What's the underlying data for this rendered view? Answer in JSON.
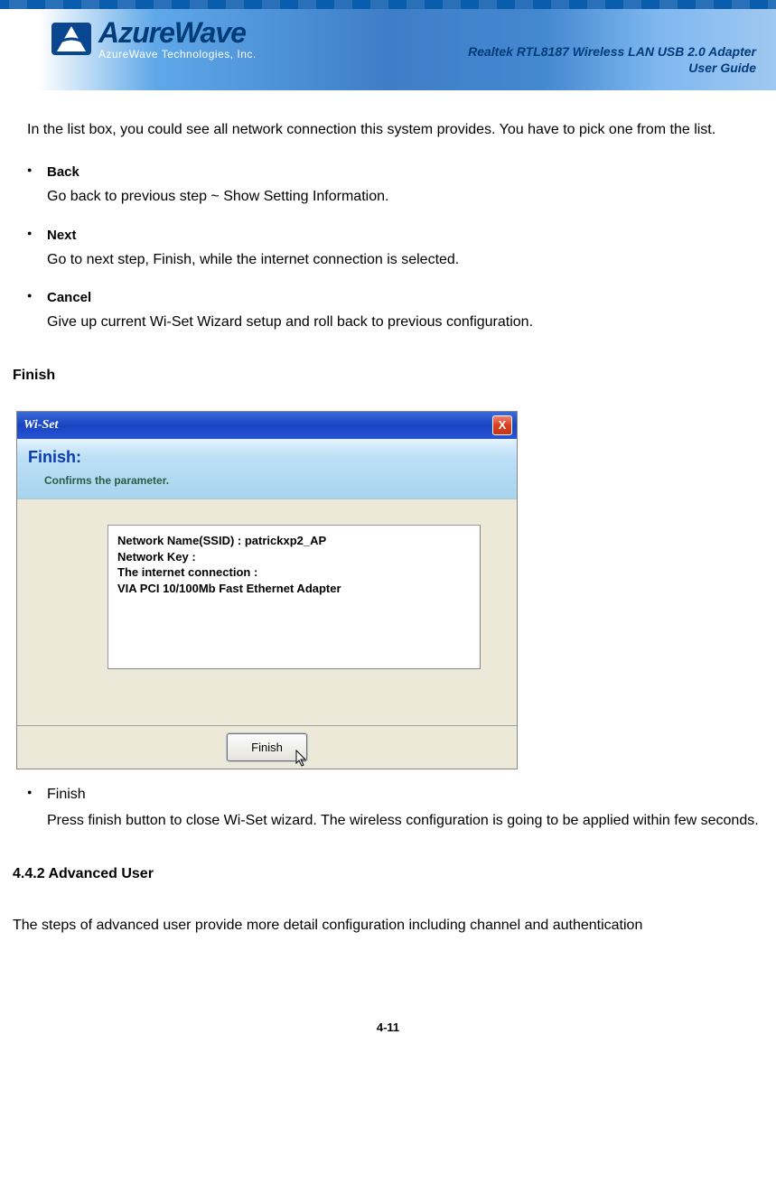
{
  "header": {
    "logo_main": "AzureWave",
    "logo_sub": "AzureWave  Technologies,  Inc.",
    "title_line1": "Realtek RTL8187 Wireless LAN USB 2.0 Adapter",
    "title_line2": "User Guide"
  },
  "intro": "In the list box, you could see all network connection this system provides. You have to pick one from the list.",
  "list": {
    "back_title": "Back",
    "back_desc": "Go back to previous step ~ Show Setting Information.",
    "next_title": "Next",
    "next_desc": "Go to next step, Finish, while the internet connection is selected.",
    "cancel_title": "Cancel",
    "cancel_desc": "Give up current Wi-Set Wizard setup and roll back to previous configuration."
  },
  "section_heading": "Finish",
  "dialog": {
    "titlebar": "Wi-Set",
    "close_label": "X",
    "sub_title": "Finish:",
    "sub_desc": "Confirms the parameter.",
    "line1": "Network Name(SSID) : patrickxp2_AP",
    "line2": "Network Key :",
    "line3": "The internet connection :",
    "line4": "VIA PCI 10/100Mb Fast Ethernet Adapter",
    "finish_btn": "Finish"
  },
  "list2": {
    "finish_title": "Finish",
    "finish_desc": "Press finish button to close Wi-Set wizard. The wireless configuration is going to be applied within few seconds."
  },
  "subsection_heading": "4.4.2 Advanced User",
  "body_para": "The steps of advanced user provide more detail configuration including channel and authentication",
  "page_number": "4-11"
}
